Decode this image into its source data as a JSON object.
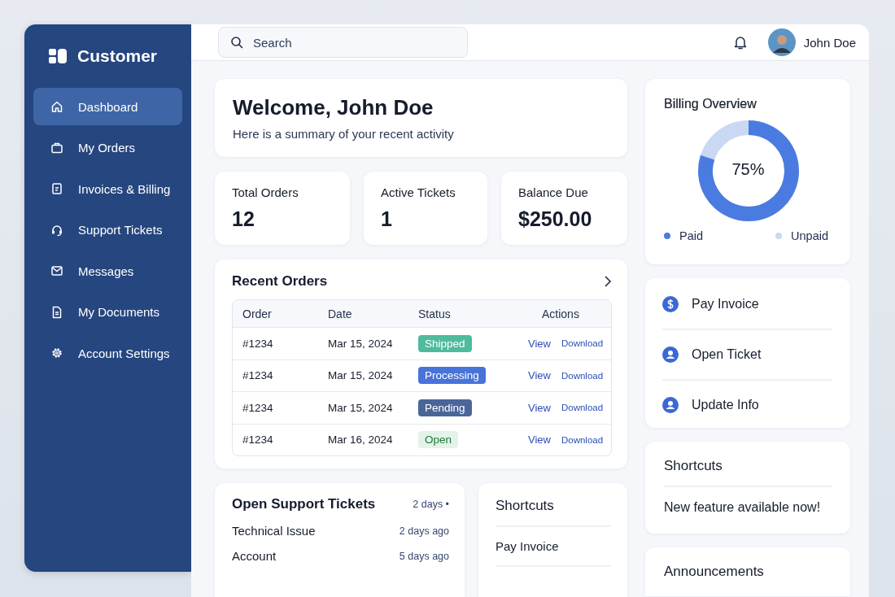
{
  "brand": "Customer",
  "sidebar": {
    "items": [
      {
        "label": "Dashboard",
        "selected": true
      },
      {
        "label": "My Orders",
        "selected": false
      },
      {
        "label": "Invoices & Billing",
        "selected": false
      },
      {
        "label": "Support Tickets",
        "selected": false
      },
      {
        "label": "Messages",
        "selected": false
      },
      {
        "label": "My Documents",
        "selected": false
      },
      {
        "label": "Account Settings",
        "selected": false
      }
    ]
  },
  "search": {
    "placeholder": "Search"
  },
  "user": {
    "name": "John Doe"
  },
  "welcome": {
    "title": "Welcome, John Doe",
    "subtitle": "Here is a summary of your recent activity"
  },
  "stats": [
    {
      "label": "Total Orders",
      "value": "12"
    },
    {
      "label": "Active Tickets",
      "value": "1"
    },
    {
      "label": "Balance Due",
      "value": "$250.00"
    }
  ],
  "recent_orders": {
    "title": "Recent Orders",
    "columns": [
      "Order",
      "Date",
      "Status",
      "Actions"
    ],
    "rows": [
      {
        "order": "#1234",
        "date": "Mar 15, 2024",
        "status": "Shipped",
        "kind": "shipped",
        "view": "View",
        "download": "Download"
      },
      {
        "order": "#1234",
        "date": "Mar 15, 2024",
        "status": "Processing",
        "kind": "processing",
        "view": "View",
        "download": "Download"
      },
      {
        "order": "#1234",
        "date": "Mar 15, 2024",
        "status": "Pending",
        "kind": "pending",
        "view": "View",
        "download": "Download"
      },
      {
        "order": "#1234",
        "date": "Mar 16, 2024",
        "status": "Open",
        "kind": "open",
        "view": "View",
        "download": "Download"
      }
    ]
  },
  "support_tickets": {
    "title": "Open Support Tickets",
    "meta": "2 days •",
    "items": [
      {
        "label": "Technical Issue",
        "time": "2 days ago"
      },
      {
        "label": "Account",
        "time": "5 days ago"
      }
    ]
  },
  "shortcuts_list": {
    "title": "Shortcuts",
    "items": [
      "Pay Invoice"
    ]
  },
  "billing": {
    "title": "Billing Overview",
    "center": "75%",
    "legend": [
      {
        "label": "Paid",
        "color": "#4a7be0"
      },
      {
        "label": "Unpaid",
        "color": "#c9d8f3"
      }
    ]
  },
  "actions": [
    {
      "label": "Pay Invoice"
    },
    {
      "label": "Open Ticket"
    },
    {
      "label": "Update Info"
    }
  ],
  "shortcuts": {
    "title": "Shortcuts",
    "text": "New feature available now!"
  },
  "announcements": {
    "title": "Announcements"
  }
}
